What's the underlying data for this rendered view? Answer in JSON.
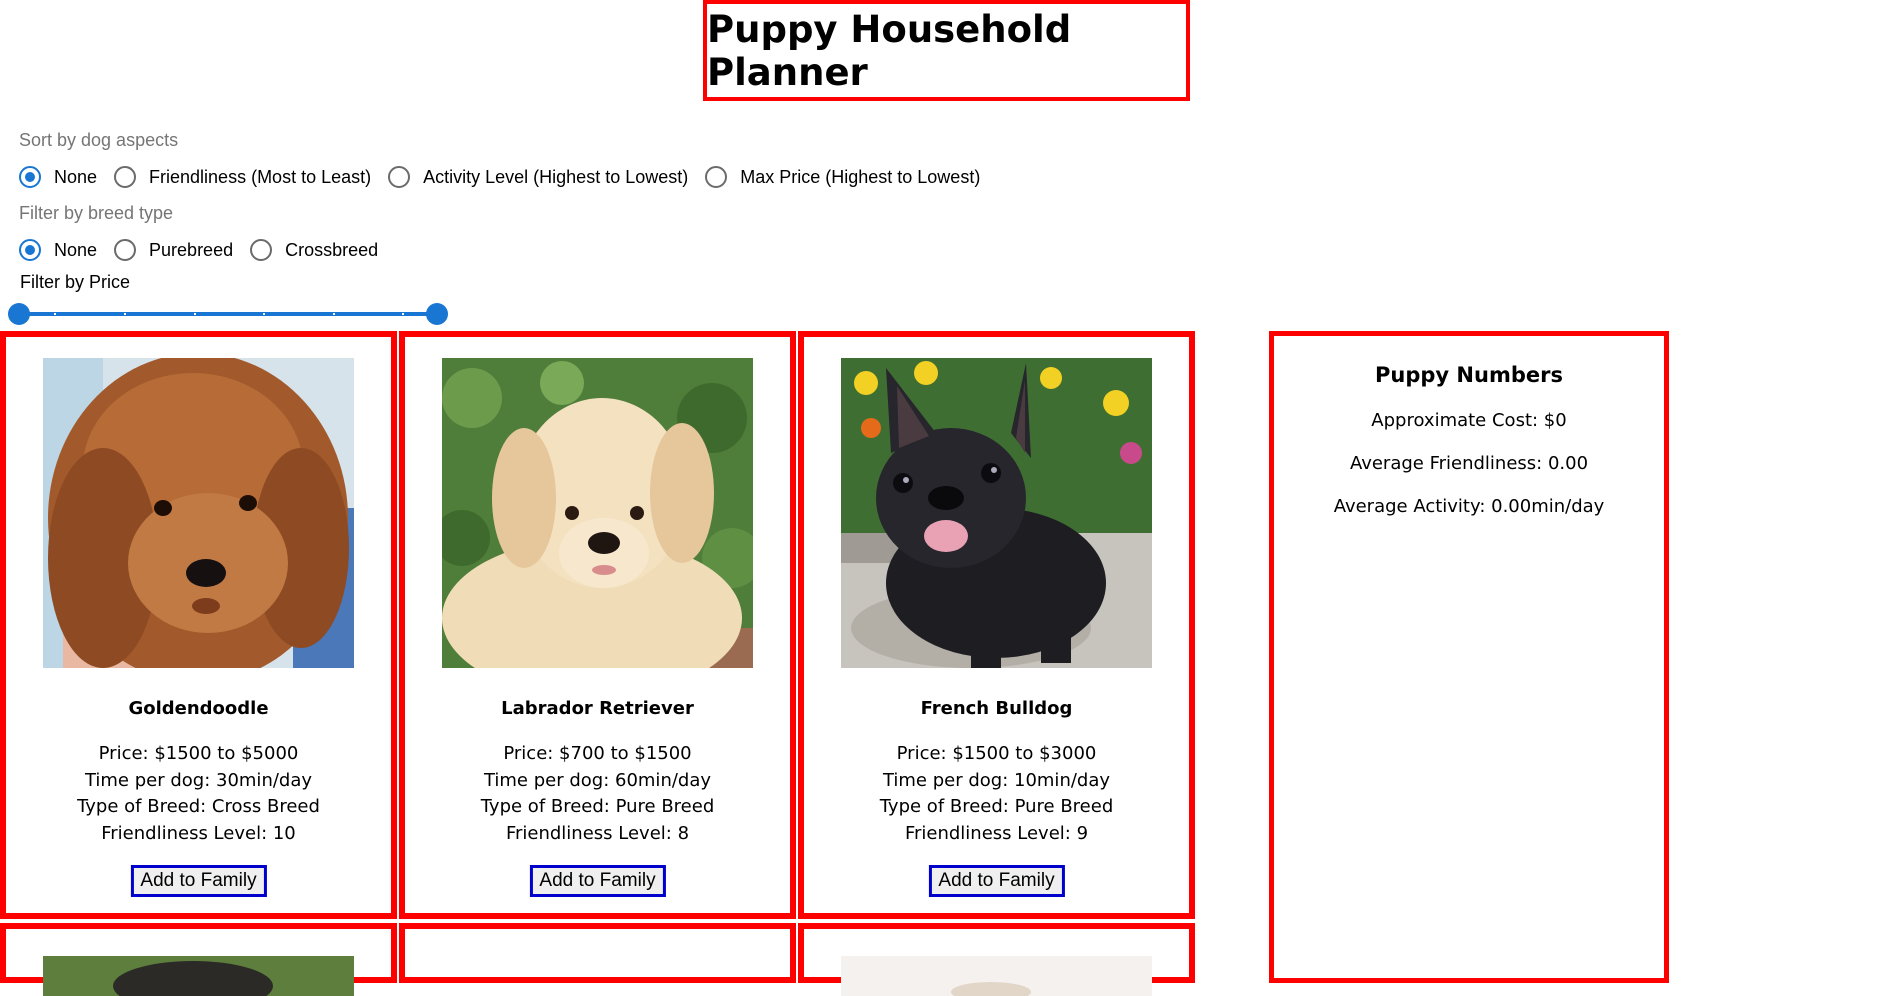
{
  "page": {
    "title": "Puppy Household Planner"
  },
  "sort": {
    "label": "Sort by dog aspects",
    "options": [
      "None",
      "Friendliness (Most to Least)",
      "Activity Level (Highest to Lowest)",
      "Max Price (Highest to Lowest)"
    ],
    "selected": "None"
  },
  "filter_breed": {
    "label": "Filter by breed type",
    "options": [
      "None",
      "Purebreed",
      "Crossbreed"
    ],
    "selected": "None"
  },
  "filter_price": {
    "label": "Filter by Price",
    "range_selected_fraction": [
      0,
      1
    ]
  },
  "dogs": [
    {
      "name": "Goldendoodle",
      "price": "Price: $1500 to $5000",
      "time": "Time per dog: 30min/day",
      "breed_type": "Type of Breed: Cross Breed",
      "friendliness": "Friendliness Level: 10",
      "button": "Add to Family"
    },
    {
      "name": "Labrador Retriever",
      "price": "Price: $700 to $1500",
      "time": "Time per dog: 60min/day",
      "breed_type": "Type of Breed: Pure Breed",
      "friendliness": "Friendliness Level: 8",
      "button": "Add to Family"
    },
    {
      "name": "French Bulldog",
      "price": "Price: $1500 to $3000",
      "time": "Time per dog: 10min/day",
      "breed_type": "Type of Breed: Pure Breed",
      "friendliness": "Friendliness Level: 9",
      "button": "Add to Family"
    }
  ],
  "summary": {
    "title": "Puppy Numbers",
    "cost": "Approximate Cost: $0",
    "friendliness": "Average Friendliness: 0.00",
    "activity": "Average Activity: 0.00min/day"
  },
  "colors": {
    "border_accent": "#ff0000",
    "control_accent": "#1976d2",
    "button_border": "#0000cc"
  }
}
